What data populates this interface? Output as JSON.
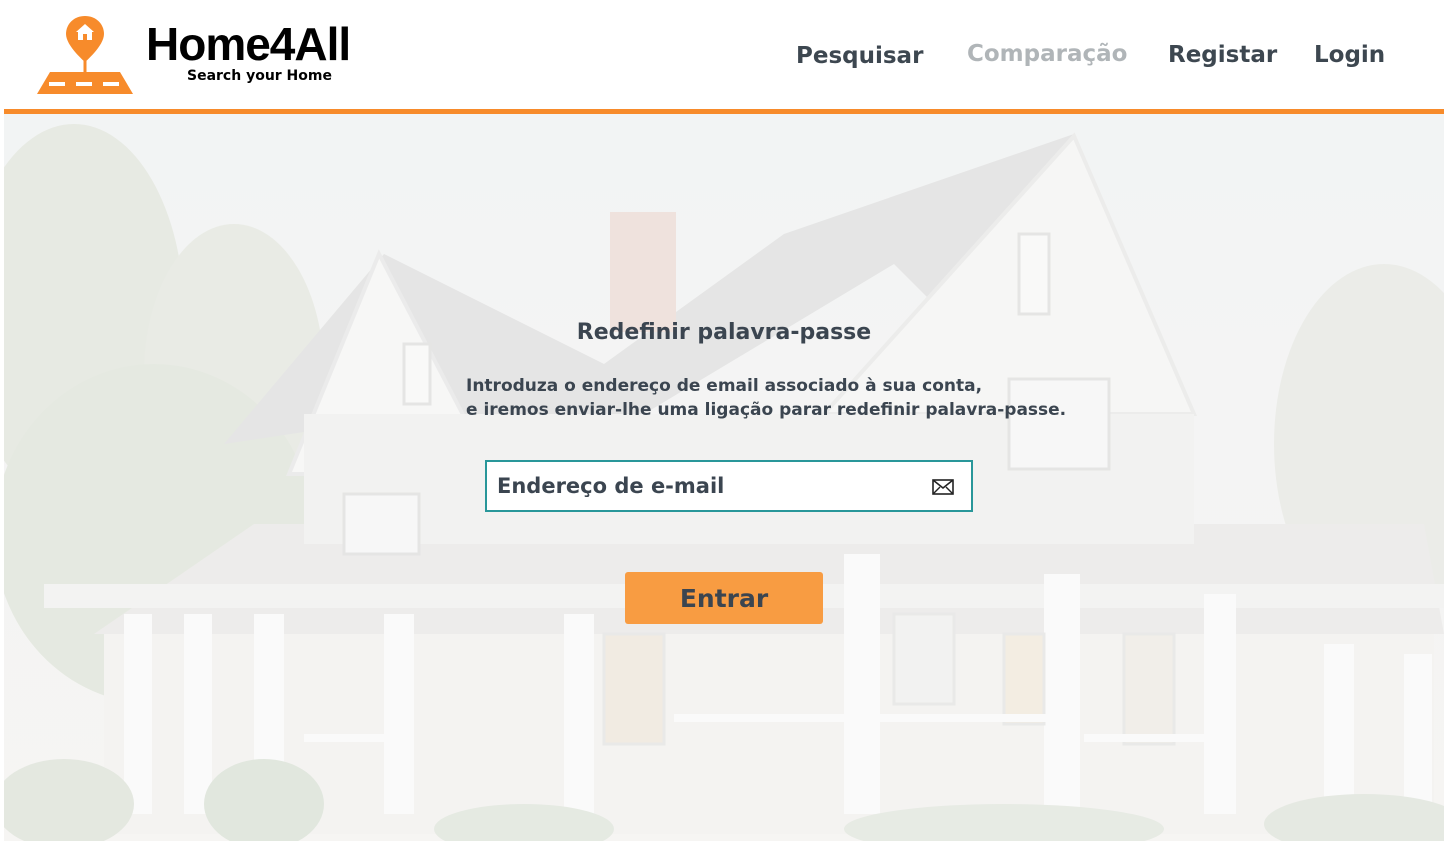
{
  "brand": {
    "name": "Home4All",
    "tagline": "Search your Home"
  },
  "nav": {
    "items": [
      {
        "label": "Pesquisar",
        "state": "enabled"
      },
      {
        "label": "Comparação",
        "state": "disabled"
      },
      {
        "label": "Registar",
        "state": "enabled"
      },
      {
        "label": "Login",
        "state": "enabled"
      }
    ]
  },
  "form": {
    "title": "Redefinir palavra-passe",
    "description_line1": "Introduza o endereço de email associado à sua conta,",
    "description_line2": "e iremos enviar-lhe uma ligação parar redefinir palavra-passe.",
    "email_placeholder": "Endereço de e-mail",
    "email_value": "",
    "email_icon": "envelope-icon",
    "submit_label": "Entrar"
  },
  "hero": {
    "image": "faded photo of a large white two-storey house with porch"
  },
  "colors": {
    "accent": "#f78b2b",
    "button": "#f89c42",
    "input_border": "#29979a",
    "text": "#3b4550",
    "nav_disabled": "#b0b5b8"
  }
}
